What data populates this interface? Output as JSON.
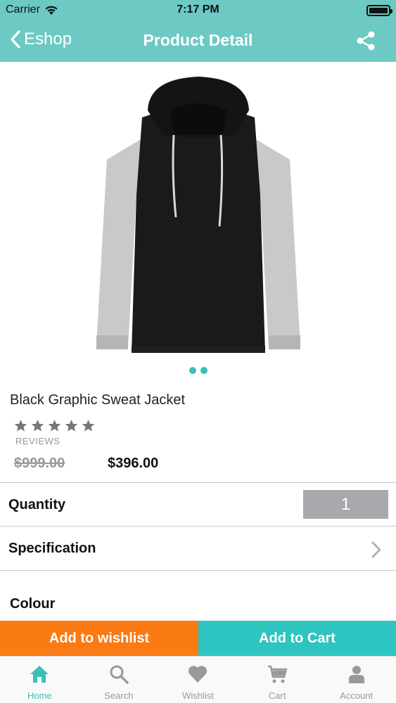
{
  "status_bar": {
    "carrier": "Carrier",
    "time": "7:17 PM"
  },
  "nav": {
    "back_label": "Eshop",
    "title": "Product Detail",
    "share_icon": "share-icon"
  },
  "product": {
    "name": "Black Graphic Sweat Jacket",
    "rating_stars": 5,
    "reviews_label": "REVIEWS",
    "old_price": "$999.00",
    "new_price": "$396.00",
    "image_pages": 2
  },
  "quantity": {
    "label": "Quantity",
    "value": "1"
  },
  "specification": {
    "label": "Specification"
  },
  "colour": {
    "label": "Colour"
  },
  "actions": {
    "wishlist_label": "Add to wishlist",
    "cart_label": "Add to Cart"
  },
  "tabs": [
    {
      "label": "Home",
      "icon": "home-icon",
      "active": true
    },
    {
      "label": "Search",
      "icon": "search-icon",
      "active": false
    },
    {
      "label": "Wishlist",
      "icon": "heart-icon",
      "active": false
    },
    {
      "label": "Cart",
      "icon": "cart-icon",
      "active": false
    },
    {
      "label": "Account",
      "icon": "user-icon",
      "active": false
    }
  ],
  "colors": {
    "header": "#6cc9c3",
    "wishlist_button": "#fa7a13",
    "cart_button": "#2ec4bf",
    "accent": "#3dbfb8"
  }
}
